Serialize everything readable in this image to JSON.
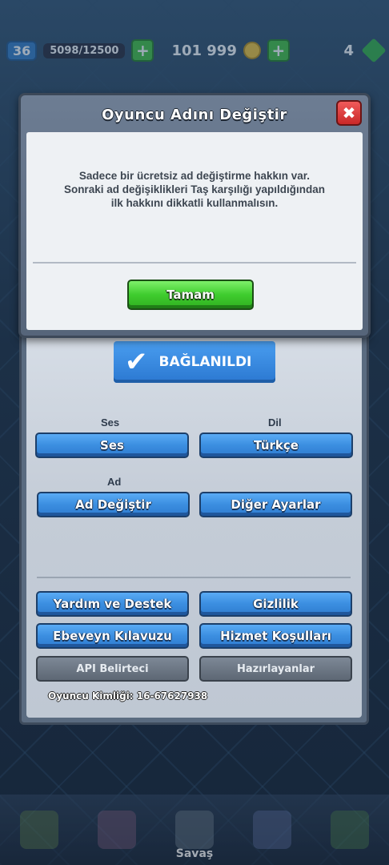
{
  "topbar": {
    "level": "36",
    "xp": "5098/12500",
    "gold": "101 999",
    "gems": "4"
  },
  "modal": {
    "title": "Oyuncu Adını Değiştir",
    "close_label": "✖",
    "message": "Sadece bir ücretsiz ad değiştirme hakkın var. Sonraki ad değişiklikleri Taş karşılığı yapıldığından ilk hakkını dikkatli kullanmalısın.",
    "ok_label": "Tamam"
  },
  "settings": {
    "connected_label": "BAĞLANILDI",
    "sound_section": "Ses",
    "sound_button": "Ses",
    "language_section": "Dil",
    "language_button": "Türkçe",
    "name_section": "Ad",
    "change_name_button": "Ad Değiştir",
    "other_settings_button": "Diğer Ayarlar",
    "help_button": "Yardım ve Destek",
    "privacy_button": "Gizlilik",
    "parent_guide_button": "Ebeveyn Kılavuzu",
    "terms_button": "Hizmet Koşulları",
    "api_button": "API Belirteci",
    "credits_button": "Hazırlayanlar",
    "player_id": "Oyuncu Kimliği: 16-67627938"
  },
  "bottom_nav": {
    "battle_label": "Savaş"
  },
  "icons": {
    "close": "close-icon",
    "check": "check-icon",
    "gold": "coin-icon",
    "gem": "gem-icon",
    "plus": "plus-icon"
  }
}
